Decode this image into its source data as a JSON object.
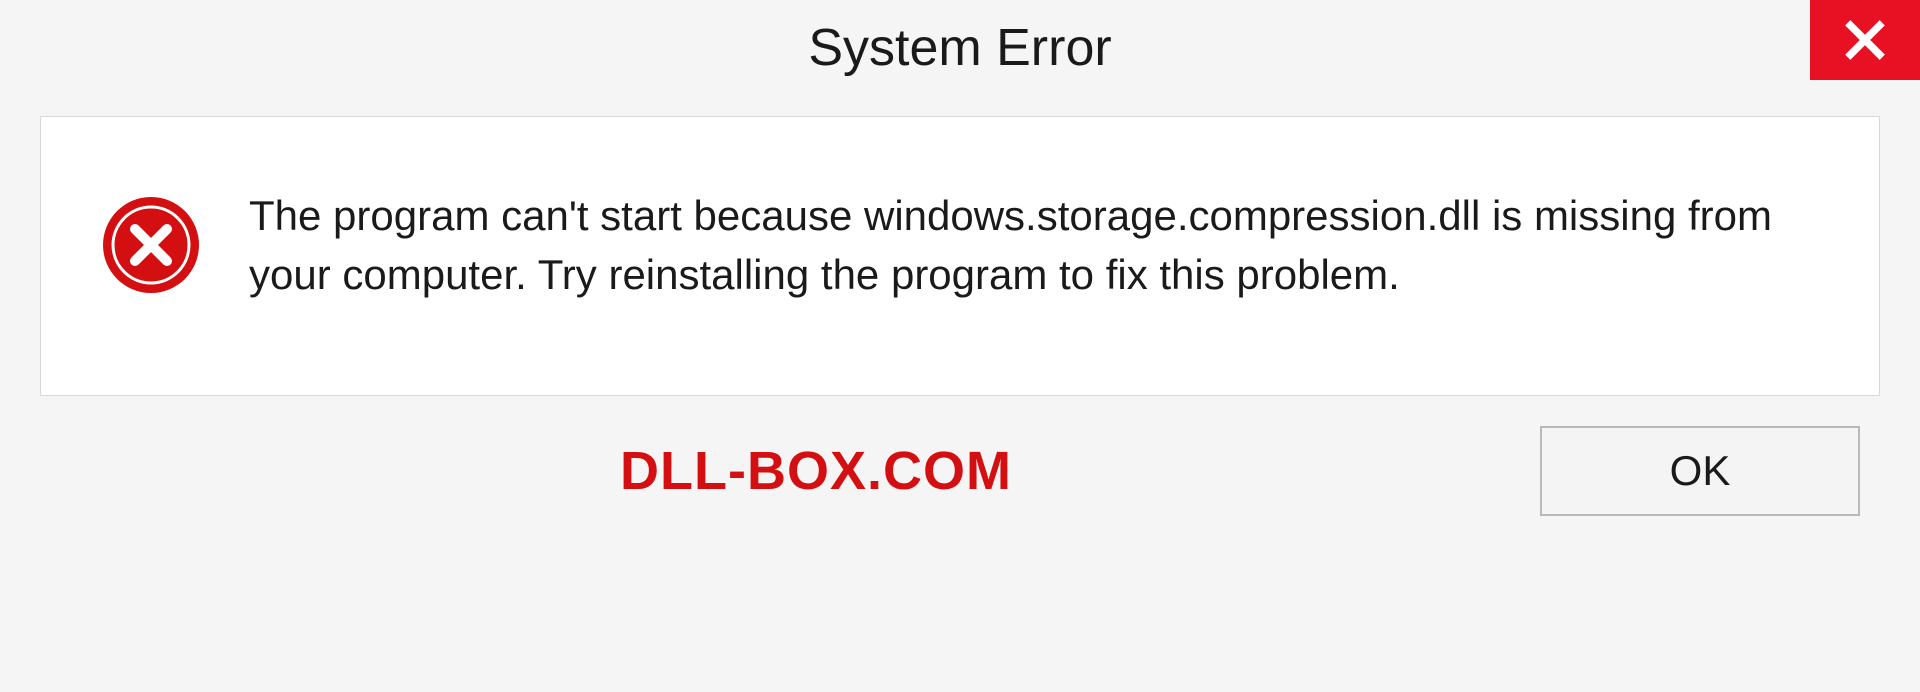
{
  "titlebar": {
    "title": "System Error"
  },
  "dialog": {
    "message": "The program can't start because windows.storage.compression.dll is missing from your computer. Try reinstalling the program to fix this problem."
  },
  "footer": {
    "watermark": "DLL-BOX.COM",
    "ok_label": "OK"
  },
  "colors": {
    "close_bg": "#e81123",
    "error_icon": "#d40f12",
    "watermark": "#d40f12"
  }
}
